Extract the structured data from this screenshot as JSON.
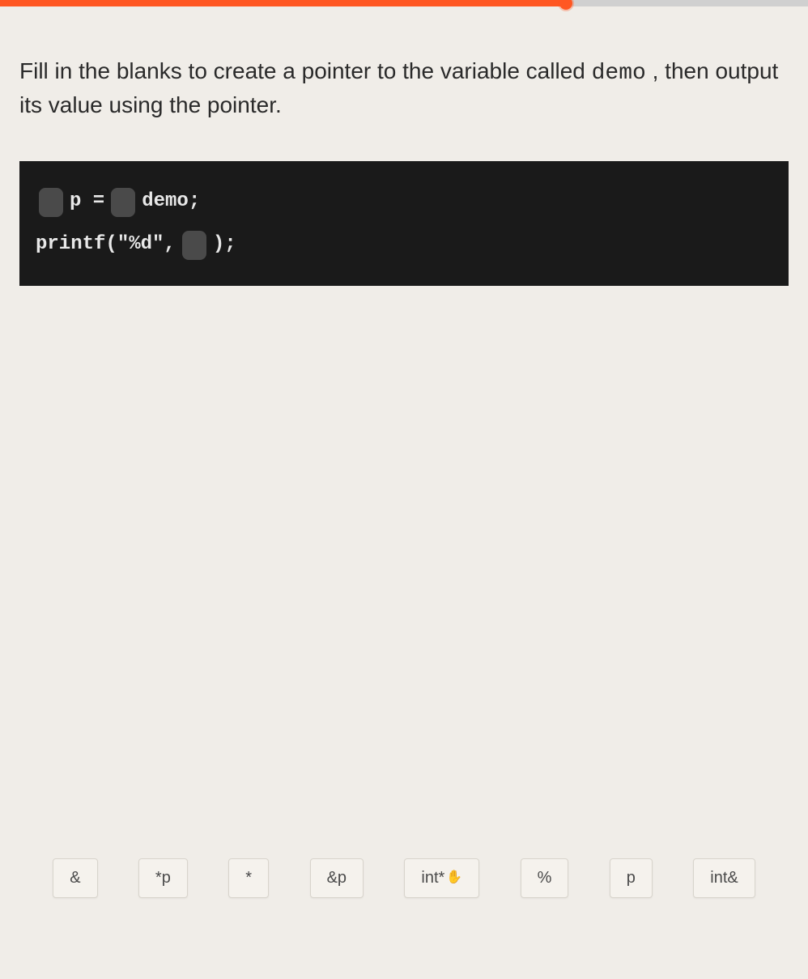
{
  "progress": {
    "percent": 70
  },
  "question": {
    "text_part1": "Fill in the blanks to create a pointer to the variable called ",
    "code_word": "demo",
    "text_part2": " , then output its value using the pointer."
  },
  "code": {
    "line1": {
      "seg1": "p =",
      "seg2": "demo;"
    },
    "line2": {
      "seg1": "printf(\"%d\",",
      "seg2": ");"
    }
  },
  "options": [
    "&",
    "*p",
    "*",
    "&p",
    "int*",
    "%",
    "p",
    "int&"
  ]
}
